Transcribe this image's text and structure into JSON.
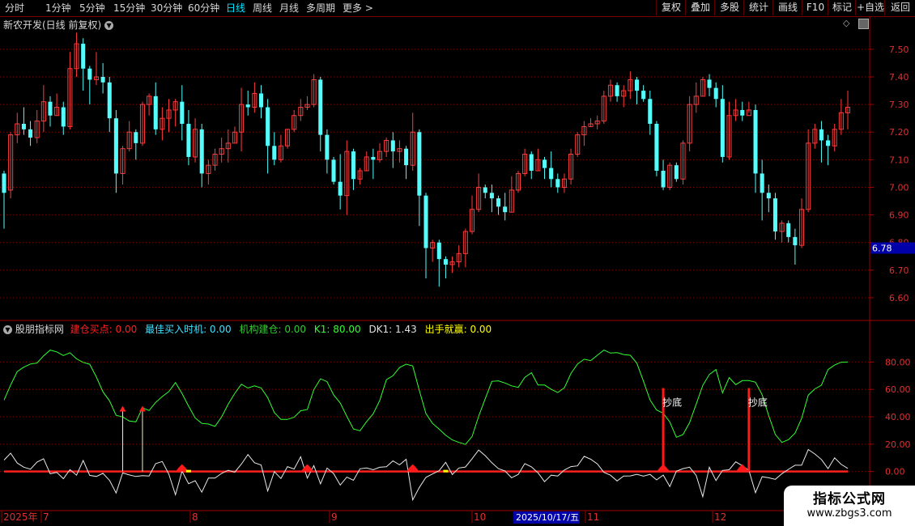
{
  "toolbar": {
    "periods": [
      "分时",
      "1分钟",
      "5分钟",
      "15分钟",
      "30分钟",
      "60分钟",
      "日线",
      "周线",
      "月线",
      "多周期",
      "更多 >"
    ],
    "active": "日线",
    "right_buttons": [
      "复权",
      "叠加",
      "多股",
      "统计",
      "画线",
      "F10",
      "标记",
      "+自选",
      "返回"
    ]
  },
  "price_panel": {
    "title": "新农开发(日线 前复权)",
    "current_price_label": "6.78",
    "y_ticks": [
      "7.50",
      "7.40",
      "7.30",
      "7.20",
      "7.10",
      "7.00",
      "6.90",
      "6.80",
      "6.70",
      "6.60"
    ]
  },
  "indicator_panel": {
    "name": "股朋指标网",
    "legend": [
      {
        "label": "建仓买点: 0.00",
        "color": "#ff2020"
      },
      {
        "label": "最佳买入时机: 0.00",
        "color": "#40e0ff"
      },
      {
        "label": "机构建仓: 0.00",
        "color": "#33cc33"
      },
      {
        "label": "K1: 80.00",
        "color": "#33ff33"
      },
      {
        "label": "DK1: 1.43",
        "color": "#e0e0e0"
      },
      {
        "label": "出手就赢: 0.00",
        "color": "#ffff00"
      }
    ],
    "y_ticks": [
      "80.00",
      "60.00",
      "40.00",
      "20.00",
      "0.00"
    ],
    "signal_labels": [
      "抄底",
      "抄底"
    ]
  },
  "x_axis": {
    "labels": [
      "2025年",
      "7",
      "8",
      "9",
      "10",
      "11",
      "12"
    ],
    "cursor_date": "2025/10/17/五"
  },
  "watermark": {
    "line1": "指标公式网",
    "line2": "www.zbgs3.com"
  },
  "colors": {
    "up": "#ff3c3c",
    "down": "#54fcfc",
    "k_line": "#33ff33",
    "dk_line": "#e8e8e8",
    "signal": "#ff2020",
    "grid": "#8a0000"
  },
  "chart_data": [
    {
      "type": "candlestick",
      "title": "新农开发(日线 前复权)",
      "ylim": [
        6.55,
        7.57
      ],
      "x_months": [
        "7",
        "8",
        "9",
        "10",
        "11",
        "12"
      ],
      "last_price": 6.78,
      "candles": [
        [
          7.05,
          6.98,
          6.85,
          7.06
        ],
        [
          6.99,
          7.19,
          6.96,
          7.2
        ],
        [
          7.19,
          7.23,
          7.16,
          7.27
        ],
        [
          7.23,
          7.21,
          7.19,
          7.29
        ],
        [
          7.21,
          7.18,
          7.15,
          7.24
        ],
        [
          7.18,
          7.24,
          7.16,
          7.28
        ],
        [
          7.24,
          7.31,
          7.2,
          7.37
        ],
        [
          7.31,
          7.26,
          7.22,
          7.33
        ],
        [
          7.26,
          7.29,
          7.26,
          7.34
        ],
        [
          7.29,
          7.22,
          7.19,
          7.31
        ],
        [
          7.22,
          7.43,
          7.21,
          7.49
        ],
        [
          7.43,
          7.52,
          7.4,
          7.56
        ],
        [
          7.52,
          7.43,
          7.35,
          7.54
        ],
        [
          7.43,
          7.39,
          7.3,
          7.44
        ],
        [
          7.39,
          7.4,
          7.37,
          7.49
        ],
        [
          7.4,
          7.38,
          7.34,
          7.45
        ],
        [
          7.38,
          7.25,
          7.2,
          7.4
        ],
        [
          7.25,
          7.05,
          6.98,
          7.28
        ],
        [
          7.05,
          7.14,
          7.01,
          7.15
        ],
        [
          7.14,
          7.2,
          7.13,
          7.24
        ],
        [
          7.2,
          7.16,
          7.1,
          7.21
        ],
        [
          7.16,
          7.3,
          7.15,
          7.31
        ],
        [
          7.3,
          7.33,
          7.26,
          7.34
        ],
        [
          7.33,
          7.21,
          7.19,
          7.38
        ],
        [
          7.21,
          7.25,
          7.17,
          7.29
        ],
        [
          7.25,
          7.28,
          7.2,
          7.32
        ],
        [
          7.28,
          7.31,
          7.22,
          7.32
        ],
        [
          7.31,
          7.23,
          7.17,
          7.37
        ],
        [
          7.23,
          7.11,
          7.08,
          7.28
        ],
        [
          7.11,
          7.21,
          7.09,
          7.25
        ],
        [
          7.21,
          7.05,
          7.0,
          7.23
        ],
        [
          7.05,
          7.08,
          7.01,
          7.1
        ],
        [
          7.08,
          7.12,
          7.06,
          7.14
        ],
        [
          7.12,
          7.14,
          7.09,
          7.18
        ],
        [
          7.14,
          7.16,
          7.09,
          7.21
        ],
        [
          7.16,
          7.2,
          7.16,
          7.22
        ],
        [
          7.2,
          7.3,
          7.13,
          7.36
        ],
        [
          7.3,
          7.29,
          7.26,
          7.35
        ],
        [
          7.29,
          7.34,
          7.27,
          7.38
        ],
        [
          7.34,
          7.29,
          7.25,
          7.37
        ],
        [
          7.29,
          7.15,
          7.05,
          7.32
        ],
        [
          7.15,
          7.1,
          7.08,
          7.2
        ],
        [
          7.1,
          7.15,
          7.09,
          7.19
        ],
        [
          7.15,
          7.21,
          7.14,
          7.21
        ],
        [
          7.21,
          7.26,
          7.2,
          7.28
        ],
        [
          7.26,
          7.29,
          7.24,
          7.32
        ],
        [
          7.29,
          7.3,
          7.28,
          7.33
        ],
        [
          7.3,
          7.39,
          7.29,
          7.41
        ],
        [
          7.39,
          7.19,
          7.13,
          7.4
        ],
        [
          7.19,
          7.1,
          7.05,
          7.21
        ],
        [
          7.1,
          7.02,
          7.01,
          7.11
        ],
        [
          7.02,
          6.97,
          6.92,
          7.12
        ],
        [
          6.97,
          7.13,
          6.9,
          7.17
        ],
        [
          7.13,
          7.03,
          6.99,
          7.14
        ],
        [
          7.03,
          7.06,
          7.01,
          7.07
        ],
        [
          7.06,
          7.11,
          7.06,
          7.13
        ],
        [
          7.11,
          7.1,
          7.03,
          7.14
        ],
        [
          7.1,
          7.13,
          7.09,
          7.16
        ],
        [
          7.13,
          7.17,
          7.11,
          7.18
        ],
        [
          7.17,
          7.13,
          7.07,
          7.2
        ],
        [
          7.13,
          7.14,
          7.09,
          7.17
        ],
        [
          7.14,
          7.08,
          7.03,
          7.15
        ],
        [
          7.08,
          7.2,
          7.06,
          7.27
        ],
        [
          7.2,
          6.97,
          6.86,
          7.21
        ],
        [
          6.97,
          6.78,
          6.67,
          6.98
        ],
        [
          6.78,
          6.8,
          6.73,
          6.81
        ],
        [
          6.8,
          6.74,
          6.64,
          6.81
        ],
        [
          6.74,
          6.72,
          6.67,
          6.75
        ],
        [
          6.72,
          6.73,
          6.69,
          6.75
        ],
        [
          6.73,
          6.76,
          6.71,
          6.79
        ],
        [
          6.76,
          6.84,
          6.71,
          6.85
        ],
        [
          6.84,
          6.92,
          6.83,
          6.97
        ],
        [
          6.92,
          7.0,
          6.91,
          7.05
        ],
        [
          7.0,
          6.98,
          6.96,
          7.01
        ],
        [
          6.98,
          6.96,
          6.91,
          7.01
        ],
        [
          6.96,
          6.93,
          6.9,
          6.97
        ],
        [
          6.93,
          6.91,
          6.88,
          6.98
        ],
        [
          6.91,
          6.99,
          6.91,
          7.04
        ],
        [
          6.99,
          7.05,
          6.98,
          7.06
        ],
        [
          7.05,
          7.12,
          7.04,
          7.14
        ],
        [
          7.12,
          7.06,
          7.03,
          7.13
        ],
        [
          7.06,
          7.1,
          7.06,
          7.14
        ],
        [
          7.1,
          7.07,
          7.03,
          7.11
        ],
        [
          7.07,
          7.03,
          7.0,
          7.13
        ],
        [
          7.03,
          7.0,
          6.98,
          7.05
        ],
        [
          7.0,
          7.03,
          6.98,
          7.05
        ],
        [
          7.03,
          7.12,
          7.01,
          7.14
        ],
        [
          7.12,
          7.19,
          7.11,
          7.2
        ],
        [
          7.19,
          7.22,
          7.15,
          7.24
        ],
        [
          7.22,
          7.23,
          7.22,
          7.25
        ],
        [
          7.23,
          7.24,
          7.21,
          7.26
        ],
        [
          7.24,
          7.33,
          7.23,
          7.35
        ],
        [
          7.33,
          7.37,
          7.31,
          7.39
        ],
        [
          7.37,
          7.33,
          7.31,
          7.38
        ],
        [
          7.33,
          7.35,
          7.29,
          7.37
        ],
        [
          7.35,
          7.39,
          7.32,
          7.42
        ],
        [
          7.39,
          7.35,
          7.3,
          7.4
        ],
        [
          7.35,
          7.32,
          7.31,
          7.37
        ],
        [
          7.32,
          7.23,
          7.19,
          7.35
        ],
        [
          7.23,
          7.06,
          7.04,
          7.24
        ],
        [
          7.06,
          7.0,
          6.99,
          7.1
        ],
        [
          7.0,
          7.08,
          6.99,
          7.09
        ],
        [
          7.08,
          7.03,
          7.02,
          7.09
        ],
        [
          7.03,
          7.16,
          7.01,
          7.17
        ],
        [
          7.16,
          7.3,
          7.13,
          7.33
        ],
        [
          7.3,
          7.33,
          7.27,
          7.38
        ],
        [
          7.33,
          7.39,
          7.33,
          7.4
        ],
        [
          7.39,
          7.36,
          7.33,
          7.41
        ],
        [
          7.36,
          7.32,
          7.29,
          7.38
        ],
        [
          7.32,
          7.11,
          7.09,
          7.37
        ],
        [
          7.11,
          7.26,
          7.1,
          7.31
        ],
        [
          7.26,
          7.28,
          7.24,
          7.32
        ],
        [
          7.28,
          7.26,
          7.24,
          7.31
        ],
        [
          7.26,
          7.28,
          7.27,
          7.31
        ],
        [
          7.28,
          7.05,
          6.98,
          7.3
        ],
        [
          7.05,
          6.98,
          6.88,
          7.1
        ],
        [
          6.98,
          6.96,
          6.91,
          7.01
        ],
        [
          6.96,
          6.84,
          6.81,
          6.98
        ],
        [
          6.84,
          6.87,
          6.8,
          6.88
        ],
        [
          6.87,
          6.82,
          6.8,
          6.88
        ],
        [
          6.82,
          6.79,
          6.72,
          6.85
        ],
        [
          6.79,
          6.92,
          6.78,
          6.96
        ],
        [
          6.92,
          7.16,
          6.91,
          7.21
        ],
        [
          7.16,
          7.21,
          7.14,
          7.23
        ],
        [
          7.21,
          7.17,
          7.09,
          7.24
        ],
        [
          7.17,
          7.15,
          7.08,
          7.19
        ],
        [
          7.15,
          7.21,
          7.13,
          7.23
        ],
        [
          7.21,
          7.27,
          7.19,
          7.32
        ],
        [
          7.27,
          7.29,
          7.21,
          7.35
        ]
      ]
    },
    {
      "type": "line",
      "title": "股朋指标网",
      "ylim": [
        -28,
        98
      ],
      "series": [
        {
          "name": "K1",
          "values": [
            52.3,
            63.2,
            73.1,
            76.3,
            78.6,
            79.3,
            84.6,
            88.8,
            87.5,
            84.8,
            86.8,
            82.4,
            79.8,
            78.4,
            69.1,
            58.3,
            51.6,
            41.1,
            39.9,
            36.9,
            36.3,
            46.6,
            44.6,
            50.5,
            54.8,
            58.4,
            65.0,
            57.0,
            47.8,
            39.1,
            35.2,
            34.7,
            33.0,
            39.8,
            49.2,
            57.1,
            63.8,
            61.0,
            62.6,
            61.1,
            54.0,
            43.1,
            38.1,
            38.1,
            39.7,
            44.4,
            45.3,
            59.9,
            67.8,
            65.7,
            56.0,
            50.1,
            40.3,
            31.1,
            29.8,
            36.4,
            42.2,
            52.0,
            67.1,
            70.0,
            76.0,
            78.5,
            77.2,
            59.2,
            42.4,
            35.2,
            31.0,
            26.5,
            23.1,
            21.3,
            19.8,
            25.6,
            40.4,
            53.3,
            65.9,
            66.3,
            64.7,
            62.6,
            61.5,
            68.8,
            72.2,
            63.3,
            63.2,
            60.1,
            57.7,
            61.2,
            71.7,
            78.6,
            82.1,
            81.1,
            85.0,
            88.8,
            86.6,
            86.9,
            85.5,
            85.0,
            79.2,
            66.1,
            52.3,
            45.0,
            42.6,
            36.2,
            25.0,
            27.0,
            35.7,
            49.3,
            62.9,
            70.9,
            74.6,
            57.5,
            68.6,
            63.5,
            66.5,
            66.5,
            65.3,
            56.1,
            40.9,
            27.1,
            21.3,
            23.3,
            28.1,
            38.9,
            55.9,
            60.4,
            63.1,
            74.5,
            77.8,
            79.9,
            80.0
          ]
        },
        {
          "name": "DK1",
          "values": [
            8.4,
            13.4,
            6.2,
            3.2,
            1.7,
            6.9,
            9.3,
            -1.6,
            -0.6,
            -5.3,
            1.4,
            -2.7,
            8.1,
            -2.8,
            -3.6,
            -1.3,
            -6.5,
            -15.7,
            -1.0,
            -2.5,
            -3.6,
            -3.0,
            -3.3,
            5.8,
            7.3,
            -1.9,
            -17.0,
            0.3,
            -8.9,
            -6.7,
            -15.1,
            -4.8,
            -4.8,
            -1.4,
            0.9,
            -0.5,
            5.4,
            12.4,
            6.4,
            4.8,
            -14.2,
            -0.1,
            -5.1,
            3.6,
            1.8,
            10.8,
            -4.8,
            4.3,
            -9.0,
            2.5,
            -1.5,
            -9.9,
            -4.1,
            -6.4,
            2.0,
            2.6,
            1.3,
            3.1,
            3.5,
            7.8,
            4.9,
            8.9,
            -20.7,
            -11.6,
            -4.3,
            -1.8,
            0.6,
            6.7,
            -2.2,
            2.6,
            3.3,
            9.3,
            15.7,
            11.6,
            6.4,
            2.1,
            0.4,
            -4.6,
            -2.1,
            5.8,
            3.4,
            -0.9,
            -7.4,
            -2.7,
            -3.3,
            1.1,
            3.6,
            4.1,
            11.1,
            9.0,
            5.6,
            -0.6,
            -2.7,
            -6.9,
            -3.3,
            -3.2,
            -2.1,
            -3.4,
            -2.1,
            -6.1,
            -2.6,
            -11.0,
            0.2,
            2.1,
            3.2,
            -2.9,
            -18.4,
            3.1,
            -6.6,
            0.8,
            1.3,
            7.1,
            4.2,
            0.8,
            -15.5,
            -3.8,
            -4.6,
            -5.7,
            -1.6,
            1.6,
            4.6,
            4.6,
            16.1,
            12.8,
            8.8,
            2.1,
            10.0,
            5.2,
            2.3
          ]
        }
      ],
      "hline": 0,
      "up_arrows": [
        18,
        21
      ],
      "red_markers": [
        27,
        46,
        62,
        100,
        112
      ],
      "yellow_markers": [
        28,
        67
      ],
      "signal_bars": [
        {
          "index": 100,
          "label": "抄底"
        },
        {
          "index": 113,
          "label": "抄底"
        }
      ]
    }
  ]
}
